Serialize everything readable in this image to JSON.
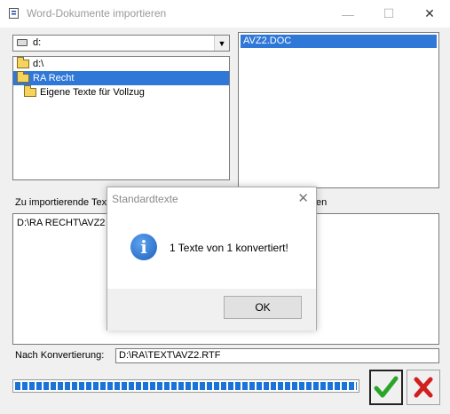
{
  "window": {
    "title": "Word-Dokumente importieren",
    "controls": [
      "—",
      "☐",
      "✕"
    ]
  },
  "drive": {
    "selected": "d:"
  },
  "tree": {
    "items": [
      {
        "label": "d:\\",
        "selected": false
      },
      {
        "label": "RA Recht",
        "selected": true
      },
      {
        "label": "Eigene Texte für Vollzug",
        "selected": false
      }
    ]
  },
  "files": {
    "items": [
      "AVZ2.DOC"
    ]
  },
  "labels": {
    "import_left": "Zu importierende Text",
    "import_right": "en",
    "after_conversion": "Nach Konvertierung:"
  },
  "import_list": {
    "items": [
      "D:\\RA RECHT\\AVZ2"
    ]
  },
  "after_conversion_value": "D:\\RA\\TEXT\\AVZ2.RTF",
  "progress": {
    "fraction": 1.0
  },
  "dialog": {
    "title": "Standardtexte",
    "close": "✕",
    "message": "1 Texte von 1 konvertiert!",
    "ok_label": "OK",
    "info_glyph": "i"
  },
  "colors": {
    "selection": "#3078d8",
    "progress": "#1a73d8",
    "ok_check": "#2aa52a",
    "cancel_x": "#d11f1f"
  },
  "icons": {
    "ok": "check-icon",
    "cancel": "cancel-x-icon",
    "info": "info-icon"
  }
}
